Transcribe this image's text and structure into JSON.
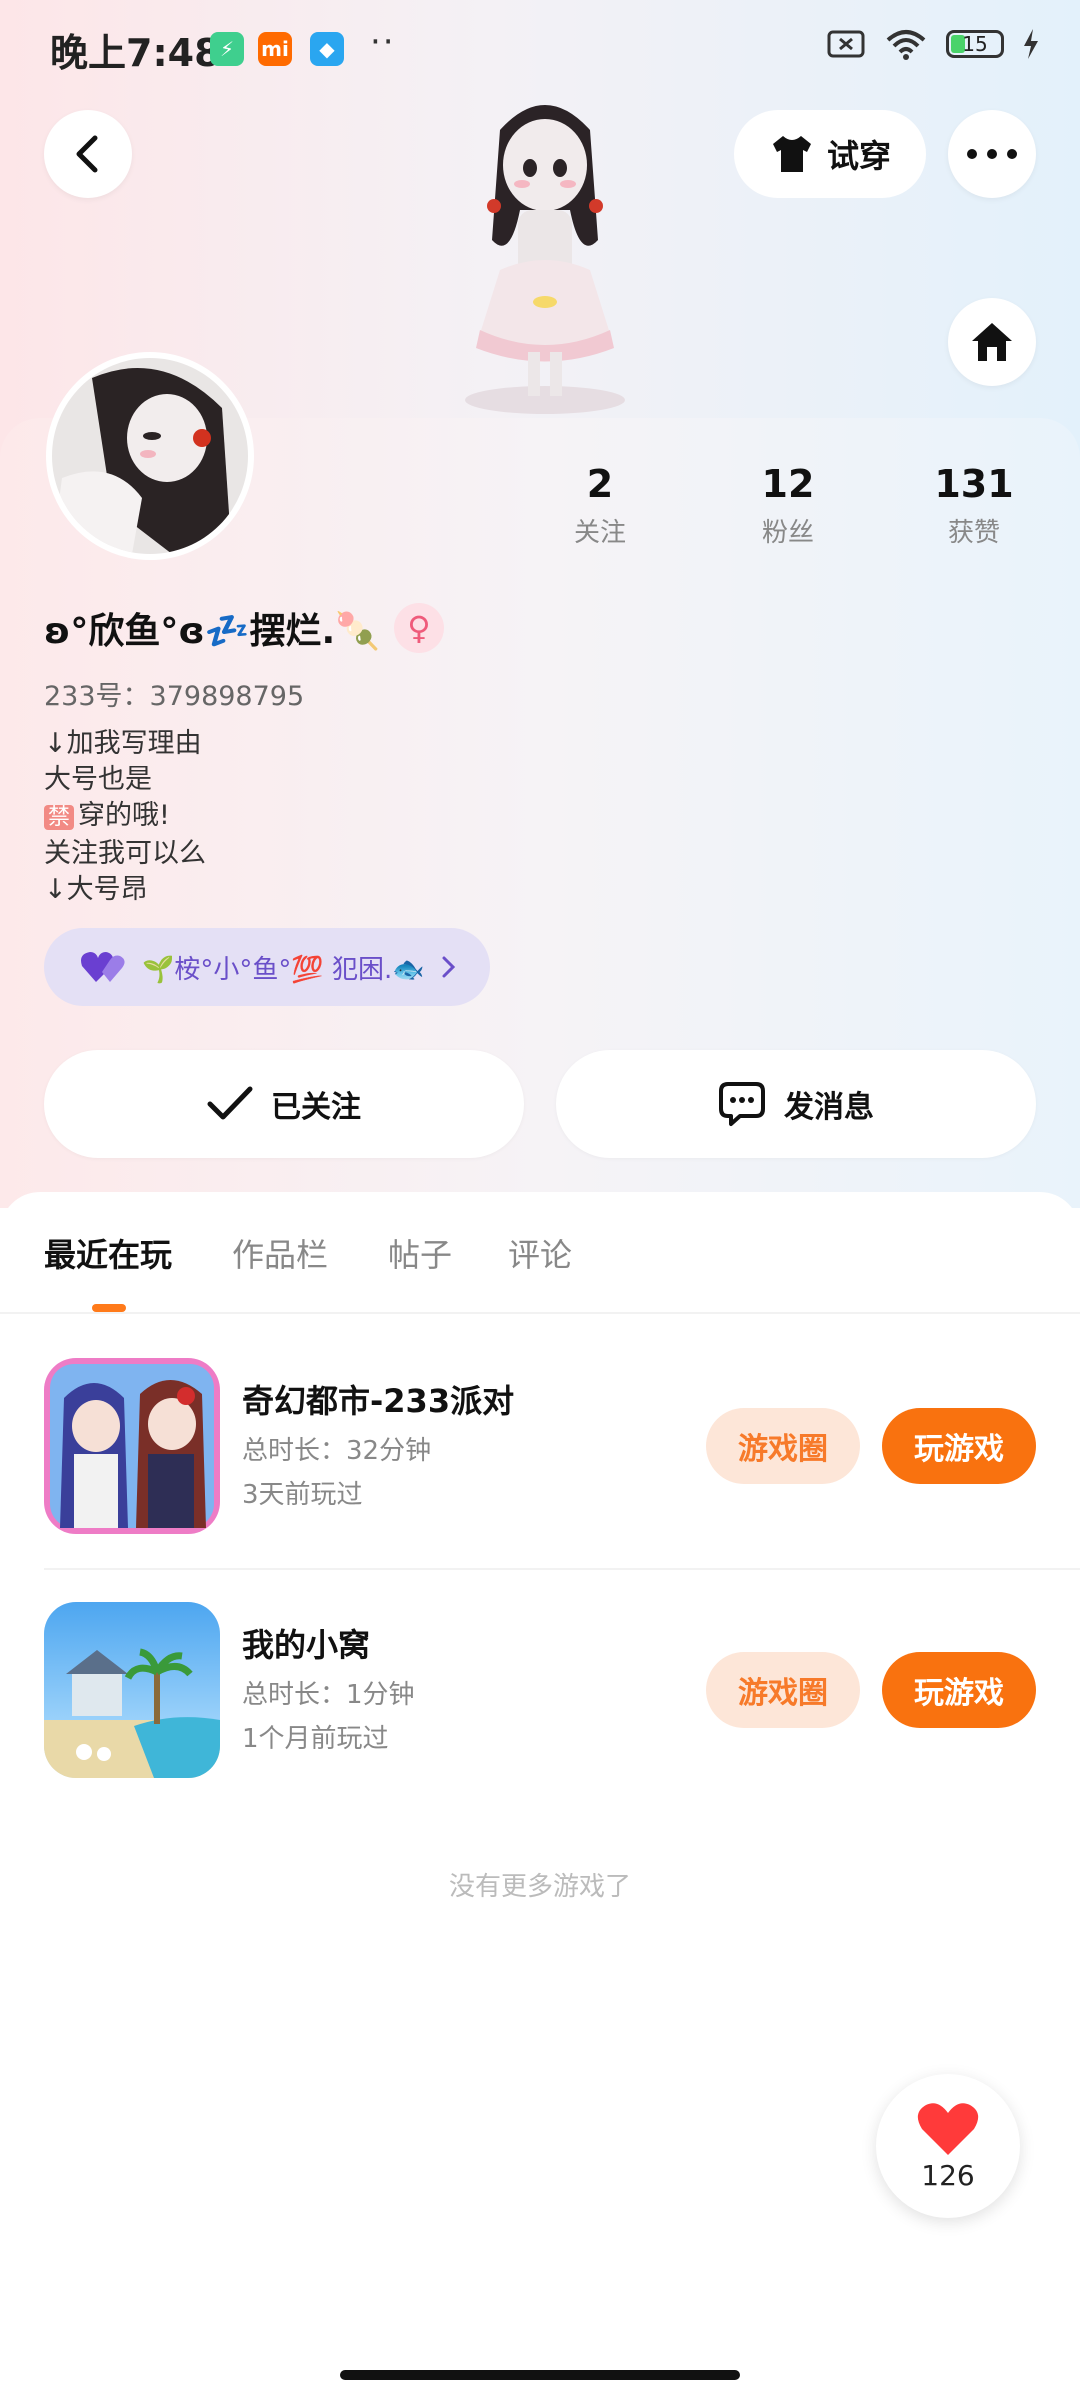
{
  "status_bar": {
    "time": "晚上7:48",
    "battery": "15",
    "dots": "··"
  },
  "header": {
    "try_on_label": "试穿"
  },
  "profile": {
    "stats": [
      {
        "value": "2",
        "label": "关注"
      },
      {
        "value": "12",
        "label": "粉丝"
      },
      {
        "value": "131",
        "label": "获赞"
      }
    ],
    "nickname": "ʚ°欣鱼°ɞ💤摆烂.🍡",
    "gender_symbol": "♀",
    "uid": "233号：379898795",
    "bio": [
      "↓加我写理由",
      "大号也是",
      "穿的哦!",
      "关注我可以么",
      "↓大号昂"
    ],
    "bio_ban_char": "禁",
    "club_label": "🌱桉°小°鱼°💯 犯困.🐟"
  },
  "actions": {
    "follow_label": "已关注",
    "message_label": "发消息"
  },
  "tabs": [
    "最近在玩",
    "作品栏",
    "帖子",
    "评论"
  ],
  "games": [
    {
      "title": "奇幻都市-233派对",
      "duration": "总时长：32分钟",
      "last_played": "3天前玩过",
      "circle_label": "游戏圈",
      "play_label": "玩游戏"
    },
    {
      "title": "我的小窝",
      "duration": "总时长：1分钟",
      "last_played": "1个月前玩过",
      "circle_label": "游戏圈",
      "play_label": "玩游戏"
    }
  ],
  "footer_note": "没有更多游戏了",
  "like_fab": {
    "count": "126"
  },
  "colors": {
    "accent": "#f9720f",
    "accent_soft": "#fde6d8",
    "club_bg": "#e4e0f5",
    "club_text": "#6a4fc9"
  },
  "icons": [
    "back-icon",
    "shirt-icon",
    "more-icon",
    "home-icon",
    "check-icon",
    "chat-icon",
    "heart-icon",
    "chevron-right-icon",
    "female-icon"
  ]
}
